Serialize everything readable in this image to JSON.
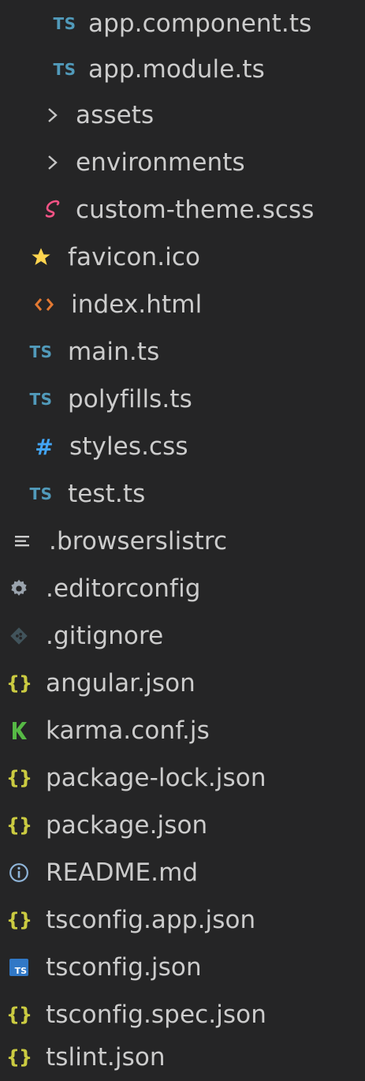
{
  "explorer": {
    "items": [
      {
        "label": "app.component.ts",
        "icon": "typescript-icon"
      },
      {
        "label": "app.module.ts",
        "icon": "typescript-icon"
      },
      {
        "label": "assets",
        "icon": "chevron-right-icon"
      },
      {
        "label": "environments",
        "icon": "chevron-right-icon"
      },
      {
        "label": "custom-theme.scss",
        "icon": "sass-icon"
      },
      {
        "label": "favicon.ico",
        "icon": "star-icon"
      },
      {
        "label": "index.html",
        "icon": "html-icon"
      },
      {
        "label": "main.ts",
        "icon": "typescript-icon"
      },
      {
        "label": "polyfills.ts",
        "icon": "typescript-icon"
      },
      {
        "label": "styles.css",
        "icon": "hash-icon"
      },
      {
        "label": "test.ts",
        "icon": "typescript-icon"
      },
      {
        "label": ".browserslistrc",
        "icon": "lines-icon"
      },
      {
        "label": ".editorconfig",
        "icon": "gear-icon"
      },
      {
        "label": ".gitignore",
        "icon": "git-icon"
      },
      {
        "label": "angular.json",
        "icon": "json-icon"
      },
      {
        "label": "karma.conf.js",
        "icon": "karma-icon"
      },
      {
        "label": "package-lock.json",
        "icon": "json-icon"
      },
      {
        "label": "package.json",
        "icon": "json-icon"
      },
      {
        "label": "README.md",
        "icon": "info-icon"
      },
      {
        "label": "tsconfig.app.json",
        "icon": "json-icon"
      },
      {
        "label": "tsconfig.json",
        "icon": "tsconfig-icon"
      },
      {
        "label": "tsconfig.spec.json",
        "icon": "json-icon"
      },
      {
        "label": "tslint.json",
        "icon": "json-icon"
      }
    ],
    "icon_text": {
      "typescript": "TS",
      "chevron": "›",
      "hash": "#",
      "json": "{}",
      "tsconfig": "TS"
    },
    "colors": {
      "background": "#252526",
      "text": "#cccccc",
      "typescript": "#519aba",
      "json": "#cbcb41",
      "sass": "#f55385",
      "star": "#ffd54f",
      "html": "#e37933",
      "css": "#42a5f5",
      "karma": "#56b945",
      "git": "#41535b",
      "info": "#8fb5d9"
    }
  }
}
